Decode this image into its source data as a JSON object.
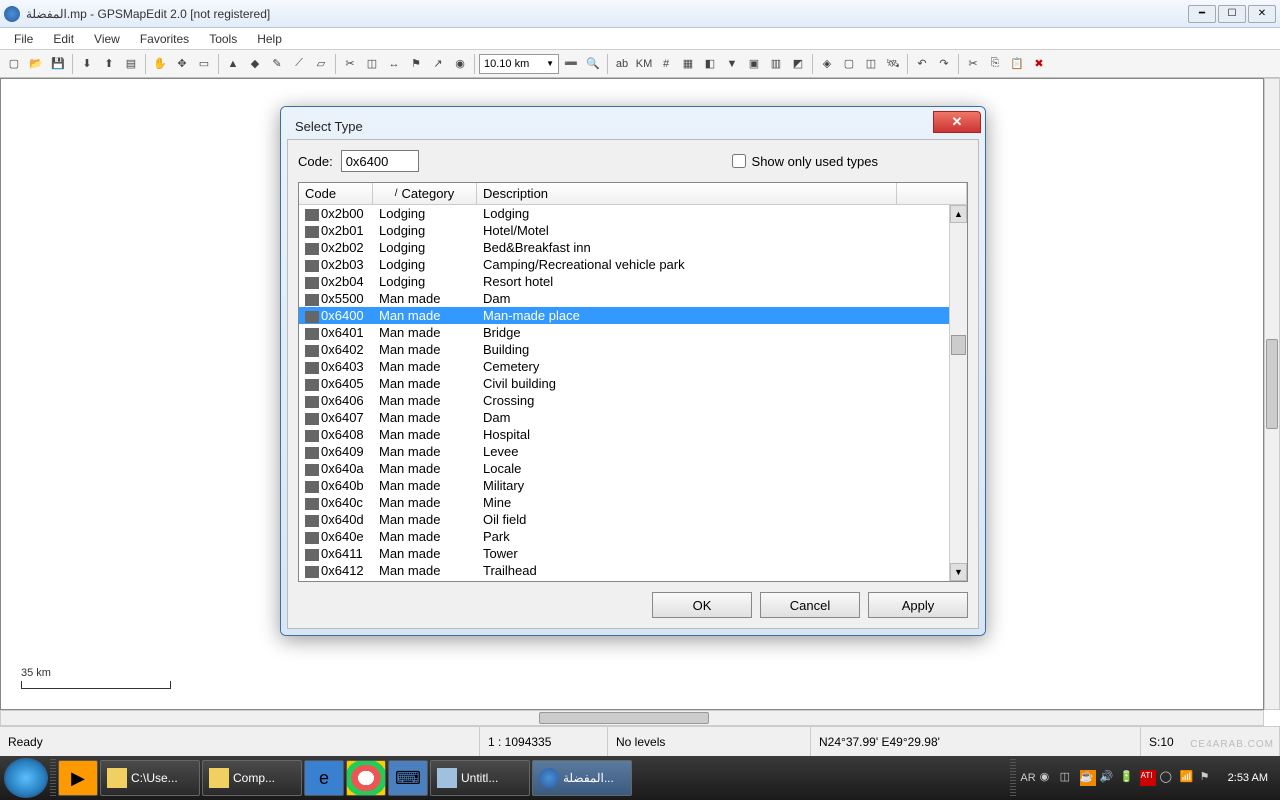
{
  "window": {
    "title": "المفضلة.mp - GPSMapEdit 2.0 [not registered]"
  },
  "menu": [
    "File",
    "Edit",
    "View",
    "Favorites",
    "Tools",
    "Help"
  ],
  "toolbar": {
    "zoom": "10.10 km"
  },
  "canvas": {
    "scale_label": "35 km"
  },
  "status": {
    "ready": "Ready",
    "ratio": "1 : 1094335",
    "levels": "No levels",
    "coords": "N24°37.99' E49°29.98'",
    "sval": "S:10"
  },
  "dialog": {
    "title": "Select Type",
    "code_label": "Code:",
    "code_value": "0x6400",
    "show_only": "Show only used types",
    "headers": {
      "code": "Code",
      "category": "Category",
      "description": "Description"
    },
    "buttons": {
      "ok": "OK",
      "cancel": "Cancel",
      "apply": "Apply"
    },
    "rows": [
      {
        "code": "0x2b00",
        "cat": "Lodging",
        "desc": "Lodging"
      },
      {
        "code": "0x2b01",
        "cat": "Lodging",
        "desc": "Hotel/Motel"
      },
      {
        "code": "0x2b02",
        "cat": "Lodging",
        "desc": "Bed&Breakfast inn"
      },
      {
        "code": "0x2b03",
        "cat": "Lodging",
        "desc": "Camping/Recreational vehicle park"
      },
      {
        "code": "0x2b04",
        "cat": "Lodging",
        "desc": "Resort hotel"
      },
      {
        "code": "0x5500",
        "cat": "Man made",
        "desc": "Dam"
      },
      {
        "code": "0x6400",
        "cat": "Man made",
        "desc": "Man-made place",
        "sel": true
      },
      {
        "code": "0x6401",
        "cat": "Man made",
        "desc": "Bridge"
      },
      {
        "code": "0x6402",
        "cat": "Man made",
        "desc": "Building"
      },
      {
        "code": "0x6403",
        "cat": "Man made",
        "desc": "Cemetery"
      },
      {
        "code": "0x6405",
        "cat": "Man made",
        "desc": "Civil building"
      },
      {
        "code": "0x6406",
        "cat": "Man made",
        "desc": "Crossing"
      },
      {
        "code": "0x6407",
        "cat": "Man made",
        "desc": "Dam"
      },
      {
        "code": "0x6408",
        "cat": "Man made",
        "desc": "Hospital"
      },
      {
        "code": "0x6409",
        "cat": "Man made",
        "desc": "Levee"
      },
      {
        "code": "0x640a",
        "cat": "Man made",
        "desc": "Locale"
      },
      {
        "code": "0x640b",
        "cat": "Man made",
        "desc": "Military"
      },
      {
        "code": "0x640c",
        "cat": "Man made",
        "desc": "Mine"
      },
      {
        "code": "0x640d",
        "cat": "Man made",
        "desc": "Oil field"
      },
      {
        "code": "0x640e",
        "cat": "Man made",
        "desc": "Park"
      },
      {
        "code": "0x6411",
        "cat": "Man made",
        "desc": "Tower"
      },
      {
        "code": "0x6412",
        "cat": "Man made",
        "desc": "Trailhead"
      }
    ]
  },
  "taskbar": {
    "lang": "AR",
    "items": [
      {
        "label": "C:\\Use..."
      },
      {
        "label": "Comp..."
      },
      {
        "label": ""
      },
      {
        "label": ""
      },
      {
        "label": ""
      },
      {
        "label": "Untitl..."
      },
      {
        "label": "المفضلة..."
      }
    ],
    "clock": "2:53 AM"
  },
  "watermark": "CE4ARAB.COM"
}
